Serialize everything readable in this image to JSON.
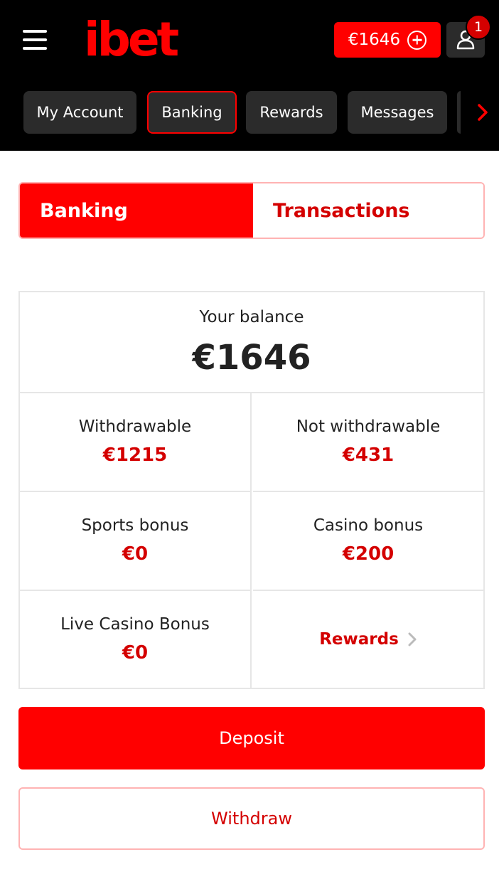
{
  "header": {
    "logo": "ibet",
    "balance": "€1646",
    "notification_count": "1"
  },
  "nav_tabs": [
    {
      "label": "My Account"
    },
    {
      "label": "Banking"
    },
    {
      "label": "Rewards"
    },
    {
      "label": "Messages"
    }
  ],
  "segment": {
    "banking": "Banking",
    "transactions": "Transactions"
  },
  "balance": {
    "label": "Your balance",
    "value": "€1646"
  },
  "cells": {
    "withdrawable": {
      "label": "Withdrawable",
      "value": "€1215"
    },
    "not_withdrawable": {
      "label": "Not withdrawable",
      "value": "€431"
    },
    "sports_bonus": {
      "label": "Sports bonus",
      "value": "€0"
    },
    "casino_bonus": {
      "label": "Casino bonus",
      "value": "€200"
    },
    "live_casino_bonus": {
      "label": "Live Casino Bonus",
      "value": "€0"
    },
    "rewards_link": "Rewards"
  },
  "actions": {
    "deposit": "Deposit",
    "withdraw": "Withdraw"
  },
  "colors": {
    "brand_red": "#ff0000",
    "dark_red_text": "#d40000",
    "header_bg": "#000000",
    "tab_bg": "#2b2b2b"
  }
}
